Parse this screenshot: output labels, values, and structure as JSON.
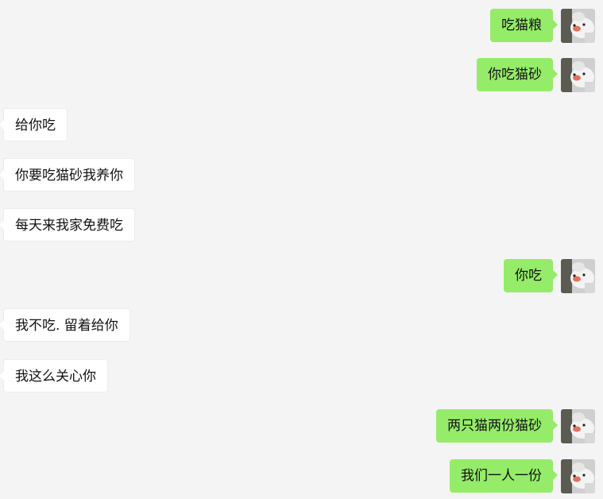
{
  "chat": {
    "colors": {
      "background": "#f4f4f4",
      "outgoing_bubble": "#95ec69",
      "incoming_bubble": "#ffffff"
    },
    "messages": [
      {
        "direction": "out",
        "text": "吃猫粮",
        "avatar": "cat-avatar-icon"
      },
      {
        "direction": "out",
        "text": "你吃猫砂",
        "avatar": "cat-avatar-icon"
      },
      {
        "direction": "in",
        "text": "给你吃"
      },
      {
        "direction": "in",
        "text": "你要吃猫砂我养你"
      },
      {
        "direction": "in",
        "text": "每天来我家免费吃"
      },
      {
        "direction": "out",
        "text": "你吃",
        "avatar": "cat-avatar-icon"
      },
      {
        "direction": "in",
        "text": "我不吃. 留着给你"
      },
      {
        "direction": "in",
        "text": "我这么关心你"
      },
      {
        "direction": "out",
        "text": "两只猫两份猫砂",
        "avatar": "cat-avatar-icon"
      },
      {
        "direction": "out",
        "text": "我们一人一份",
        "avatar": "cat-avatar-icon"
      }
    ]
  }
}
